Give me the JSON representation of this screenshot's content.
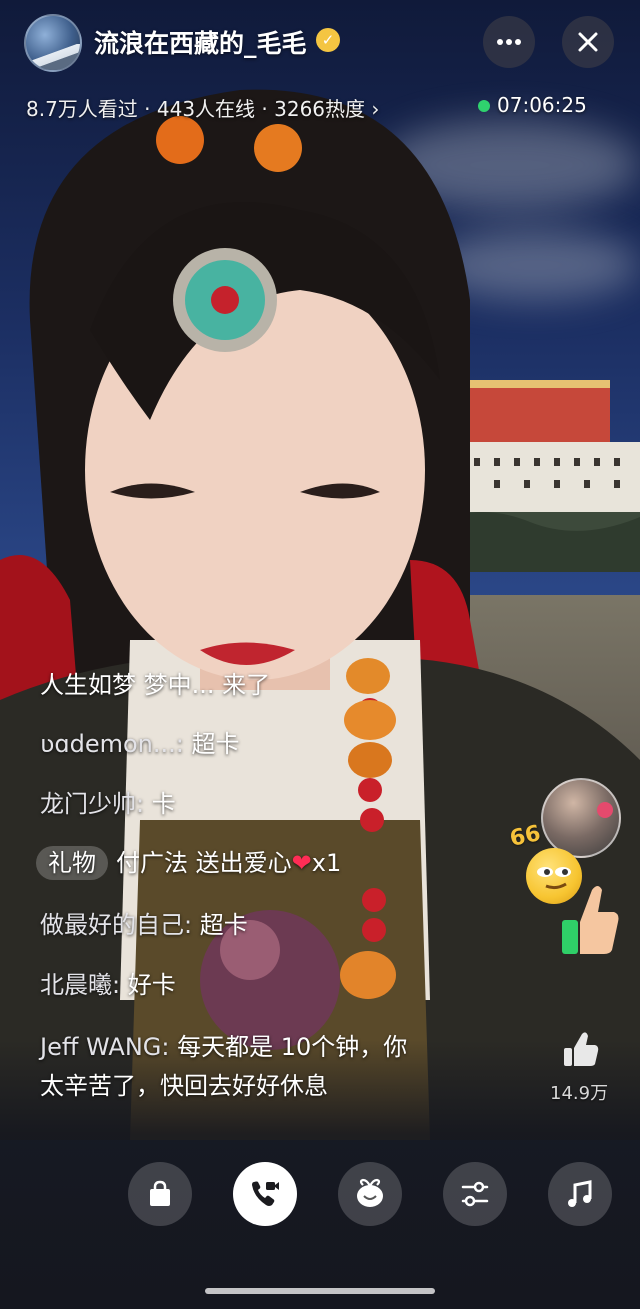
{
  "header": {
    "host_name": "流浪在西藏的_毛毛",
    "verified_icon": "verified-badge-icon",
    "more_icon": "more-dots-icon",
    "close_icon": "close-icon",
    "stats": "8.7万人看过 · 443人在线 · 3266热度 ›",
    "live_time": "07:06:25"
  },
  "comments": [
    {
      "user": "",
      "msg": "人生如梦 梦中... 来了"
    },
    {
      "user": "ʋɑdemon...: ",
      "msg": "超卡"
    },
    {
      "user": "龙门少帅: ",
      "msg": "卡"
    },
    {
      "tag": "礼物",
      "user": "付广法 ",
      "msg": "送出爱心",
      "heart": "❤",
      "count": "x1"
    },
    {
      "user": "做最好的自己: ",
      "msg": "超卡"
    },
    {
      "user": "北晨曦: ",
      "msg": "好卡"
    },
    {
      "user": "Jeff WANG: ",
      "msg": "每天都是 10个钟，你",
      "msg2": "太辛苦了，快回去好好休息"
    }
  ],
  "side": {
    "like_count": "14.9万",
    "emoji_text": "66"
  },
  "toolbar": {
    "items": [
      "shopping-bag-icon",
      "video-call-icon",
      "gift-icon",
      "settings-sliders-icon",
      "music-icon"
    ]
  },
  "colors": {
    "accent_live": "#2fd26e",
    "verified": "#f4c542",
    "heart": "#ff2d55"
  }
}
